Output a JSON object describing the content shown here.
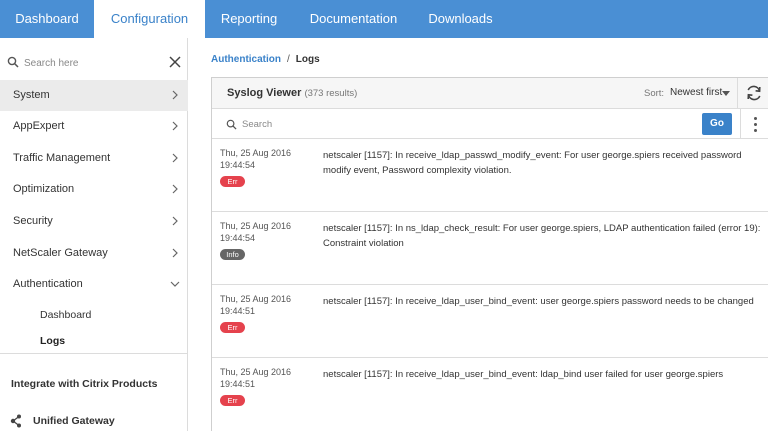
{
  "topnav": {
    "tabs": [
      {
        "label": "Dashboard",
        "active": false
      },
      {
        "label": "Configuration",
        "active": true
      },
      {
        "label": "Reporting",
        "active": false
      },
      {
        "label": "Documentation",
        "active": false
      },
      {
        "label": "Downloads",
        "active": false
      }
    ]
  },
  "sidebar": {
    "search": {
      "placeholder": "Search here",
      "value": ""
    },
    "items": [
      {
        "label": "System"
      },
      {
        "label": "AppExpert"
      },
      {
        "label": "Traffic Management"
      },
      {
        "label": "Optimization"
      },
      {
        "label": "Security"
      },
      {
        "label": "NetScaler Gateway"
      },
      {
        "label": "Authentication"
      }
    ],
    "sub_items": [
      {
        "label": "Dashboard"
      },
      {
        "label": "Logs"
      }
    ],
    "integrate_heading": "Integrate with Citrix Products",
    "unified_gateway": "Unified Gateway"
  },
  "breadcrumb": {
    "parent": "Authentication",
    "separator": "/",
    "current": "Logs"
  },
  "panel": {
    "title": "Syslog Viewer",
    "count": "(373 results)",
    "sort_label": "Sort:",
    "sort_value": "Newest first",
    "search_placeholder": "Search",
    "go_label": "Go",
    "logs": [
      {
        "date": "Thu, 25 Aug 2016",
        "time": "19:44:54",
        "level": "Err",
        "message": "netscaler [1157]: In receive_ldap_passwd_modify_event: For user george.spiers received password modify event, Password complexity violation."
      },
      {
        "date": "Thu, 25 Aug 2016",
        "time": "19:44:54",
        "level": "Info",
        "message": "netscaler [1157]: In ns_ldap_check_result: For user george.spiers, LDAP authentication failed (error 19): Constraint violation"
      },
      {
        "date": "Thu, 25 Aug 2016",
        "time": "19:44:51",
        "level": "Err",
        "message": "netscaler [1157]: In receive_ldap_user_bind_event: user george.spiers password needs to be changed"
      },
      {
        "date": "Thu, 25 Aug 2016",
        "time": "19:44:51",
        "level": "Err",
        "message": "netscaler [1157]: In receive_ldap_user_bind_event: ldap_bind user failed for user george.spiers"
      }
    ]
  },
  "colors": {
    "nav_bg": "#4a8fd4",
    "accent": "#3a82c9",
    "err_badge": "#e5424d",
    "info_badge": "#666666"
  }
}
